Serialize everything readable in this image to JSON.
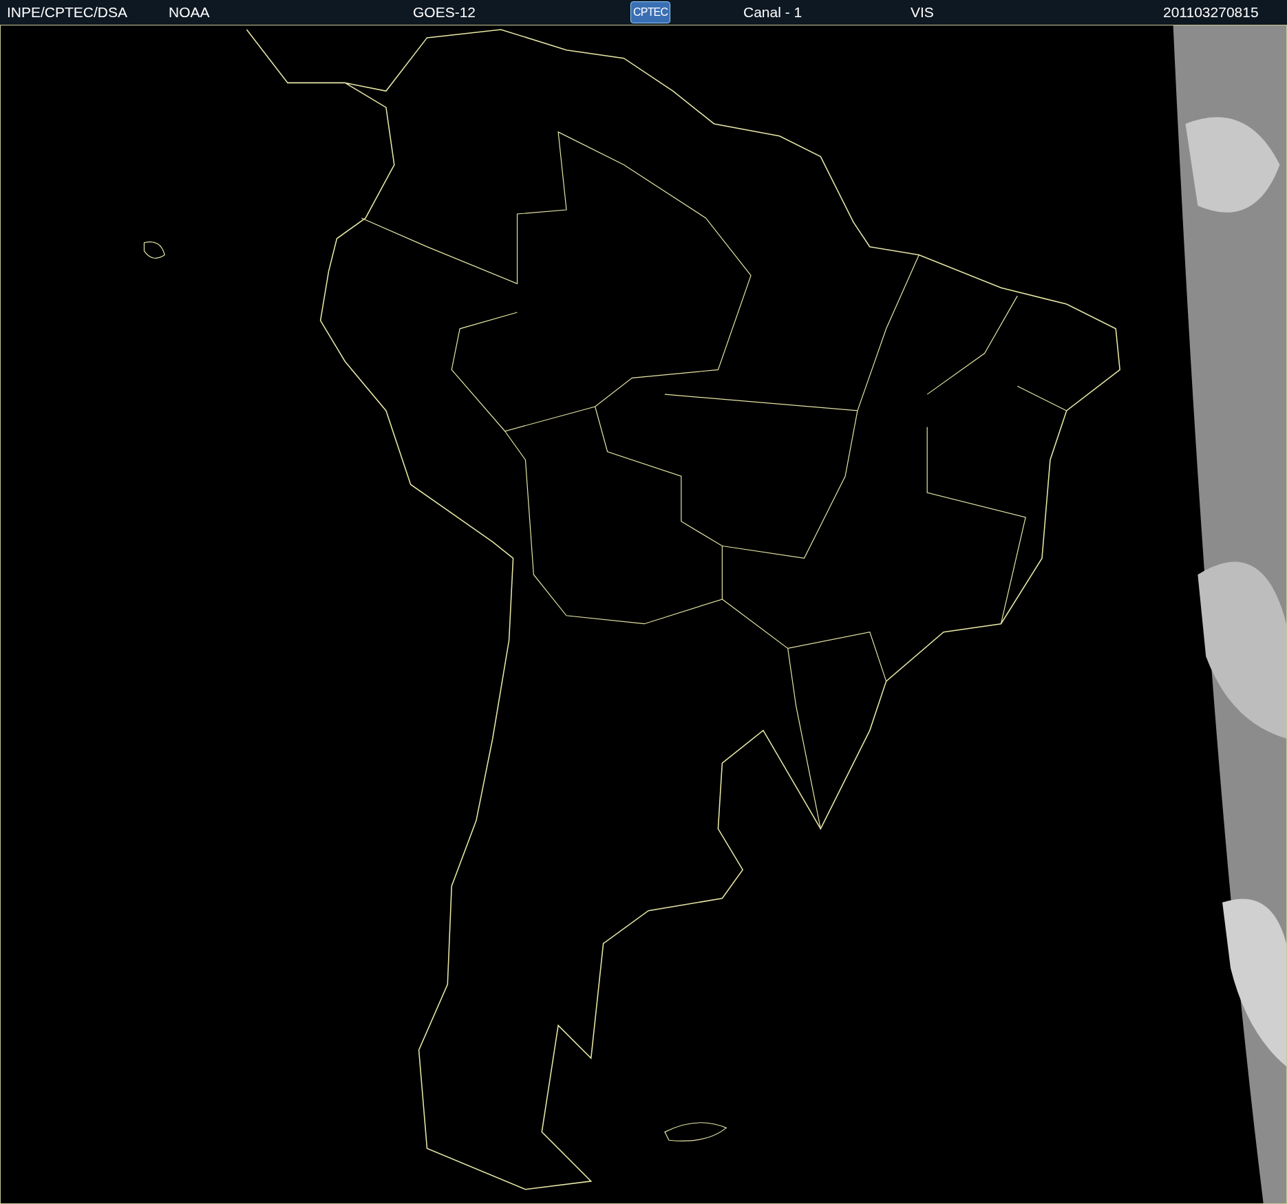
{
  "header": {
    "items": [
      {
        "kind": "text",
        "text": "INPE/CPTEC/DSA"
      },
      {
        "kind": "text",
        "text": "NOAA"
      },
      {
        "kind": "text",
        "text": "GOES-12"
      },
      {
        "kind": "logo",
        "text": "CPTEC"
      },
      {
        "kind": "text",
        "text": "Canal - 1"
      },
      {
        "kind": "text",
        "text": "VIS"
      },
      {
        "kind": "text",
        "text": "201103270815"
      }
    ]
  }
}
